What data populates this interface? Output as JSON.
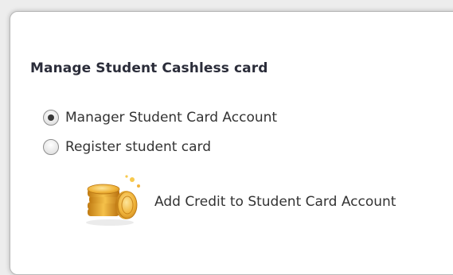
{
  "card": {
    "title": "Manage Student Cashless card"
  },
  "options": [
    {
      "label": "Manager Student Card Account",
      "checked": true
    },
    {
      "label": "Register student card",
      "checked": false
    }
  ],
  "actions": {
    "add_credit_label": "Add Credit to Student Card Account",
    "add_credit_icon": "coins-icon"
  },
  "colors": {
    "background": "#ededed",
    "panel": "#ffffff",
    "text": "#333333",
    "title": "#2b2d3a",
    "coin": "#e0a12b"
  }
}
